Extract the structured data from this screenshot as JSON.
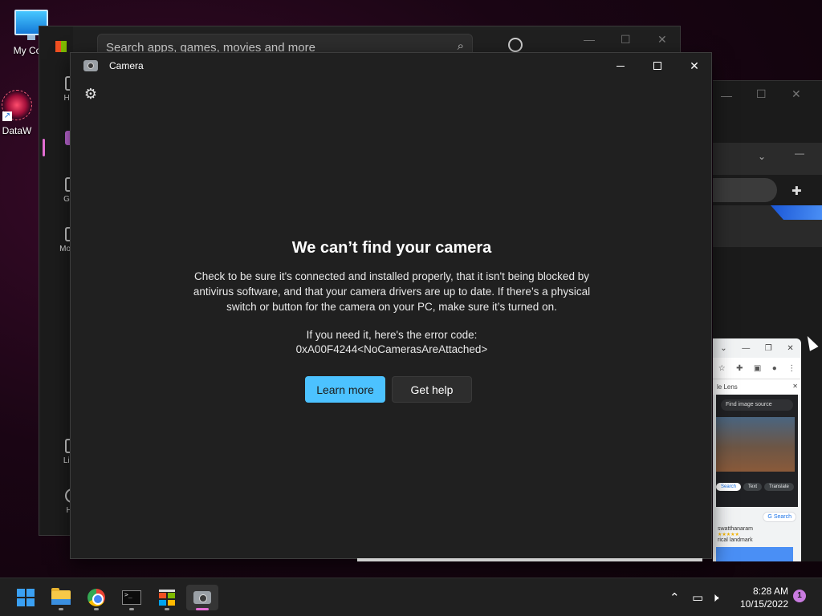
{
  "desktop": {
    "icons": [
      {
        "label": "My Com"
      },
      {
        "label": "DataW"
      }
    ]
  },
  "store": {
    "search_placeholder": "Search apps, games, movies and more",
    "nav": [
      {
        "label": "Hom"
      },
      {
        "label": ""
      },
      {
        "label": "Gam"
      },
      {
        "label": "Movies"
      },
      {
        "label": "Libra"
      },
      {
        "label": "Hel"
      }
    ]
  },
  "camera": {
    "title": "Camera",
    "error_title": "We can’t find your camera",
    "error_body": "Check to be sure it's connected and installed properly, that it isn't being blocked by antivirus software, and that your camera drivers are up to date. If there’s a physical switch or button for the camera on your PC, make sure it’s turned on.",
    "error_code_label": "If you need it, here's the error code:",
    "error_code": "0xA00F4244<NoCamerasAreAttached>",
    "learn_more": "Learn more",
    "get_help": "Get help"
  },
  "mini_popup": {
    "lens_title": "le Lens",
    "find_source": "Find image source",
    "pills": [
      "Search",
      "Text",
      "Translate"
    ],
    "google_search": "Search",
    "result_title": "swatthanaram",
    "result_sub": "rical landmark"
  },
  "taskbar": {
    "time": "8:28 AM",
    "date": "10/15/2022",
    "notification_count": "1"
  }
}
